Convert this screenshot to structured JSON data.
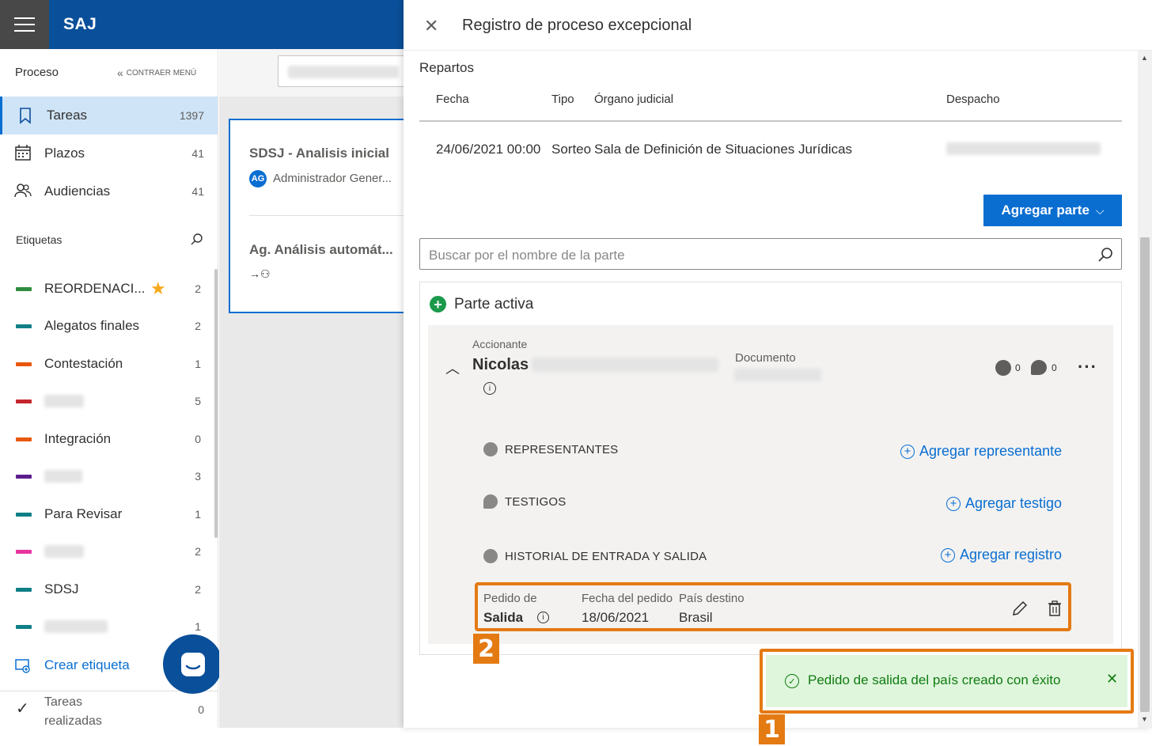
{
  "header": {
    "brand": "SAJ"
  },
  "sidebar": {
    "section_title": "Proceso",
    "collapse_label": "CONTRAER MENÚ",
    "nav": [
      {
        "label": "Tareas",
        "count": "1397"
      },
      {
        "label": "Plazos",
        "count": "41"
      },
      {
        "label": "Audiencias",
        "count": "41"
      }
    ],
    "tags_title": "Etiquetas",
    "tags": [
      {
        "label": "REORDENACI...",
        "count": "2",
        "color": "#2e8b3e",
        "starred": true
      },
      {
        "label": "Alegatos finales",
        "count": "2",
        "color": "#0f7f86"
      },
      {
        "label": "Contestación",
        "count": "1",
        "color": "#e8570e"
      },
      {
        "label": "",
        "count": "5",
        "color": "#c4262e"
      },
      {
        "label": "Integración",
        "count": "0",
        "color": "#e8570e"
      },
      {
        "label": "",
        "count": "3",
        "color": "#5c1e8e"
      },
      {
        "label": "Para Revisar",
        "count": "1",
        "color": "#0f7f86"
      },
      {
        "label": "",
        "count": "2",
        "color": "#e8349f"
      },
      {
        "label": "SDSJ",
        "count": "2",
        "color": "#0f7f86"
      },
      {
        "label": "",
        "count": "1",
        "color": "#0f7f86"
      }
    ],
    "create_tag": "Crear etiqueta",
    "done": {
      "label_line1": "Tareas",
      "label_line2": "realizadas",
      "count": "0"
    }
  },
  "middle": {
    "card": {
      "title1": "SDSJ - Analisis inicial",
      "avatar": "AG",
      "user": "Administrador Gener...",
      "title2": "Ag. Análisis automát..."
    }
  },
  "panel": {
    "title": "Registro de proceso excepcional",
    "repartos": {
      "heading": "Repartos",
      "columns": [
        "Fecha",
        "Tipo",
        "Órgano judicial",
        "Despacho"
      ],
      "row": {
        "fecha": "24/06/2021 00:00",
        "tipo": "Sorteo",
        "organo": "Sala de Definición de Situaciones Jurídicas"
      }
    },
    "add_party_button": "Agregar parte",
    "search_placeholder": "Buscar por el nombre de la parte",
    "active_party": {
      "heading": "Parte activa",
      "role": "Accionante",
      "name": "Nicolas",
      "document_label": "Documento",
      "rep_count": "0",
      "comment_count": "0",
      "sections": [
        {
          "label": "REPRESENTANTES",
          "action": "Agregar representante"
        },
        {
          "label": "TESTIGOS",
          "action": "Agregar testigo"
        },
        {
          "label": "HISTORIAL DE ENTRADA Y SALIDA",
          "action": "Agregar registro"
        }
      ],
      "record": {
        "label_pedido": "Pedido de",
        "value_pedido": "Salida",
        "label_fecha": "Fecha del pedido",
        "value_fecha": "18/06/2021",
        "label_pais": "País destino",
        "value_pais": "Brasil"
      }
    }
  },
  "toast": {
    "message": "Pedido de salida del país creado con éxito"
  },
  "callouts": {
    "one": "1",
    "two": "2"
  }
}
